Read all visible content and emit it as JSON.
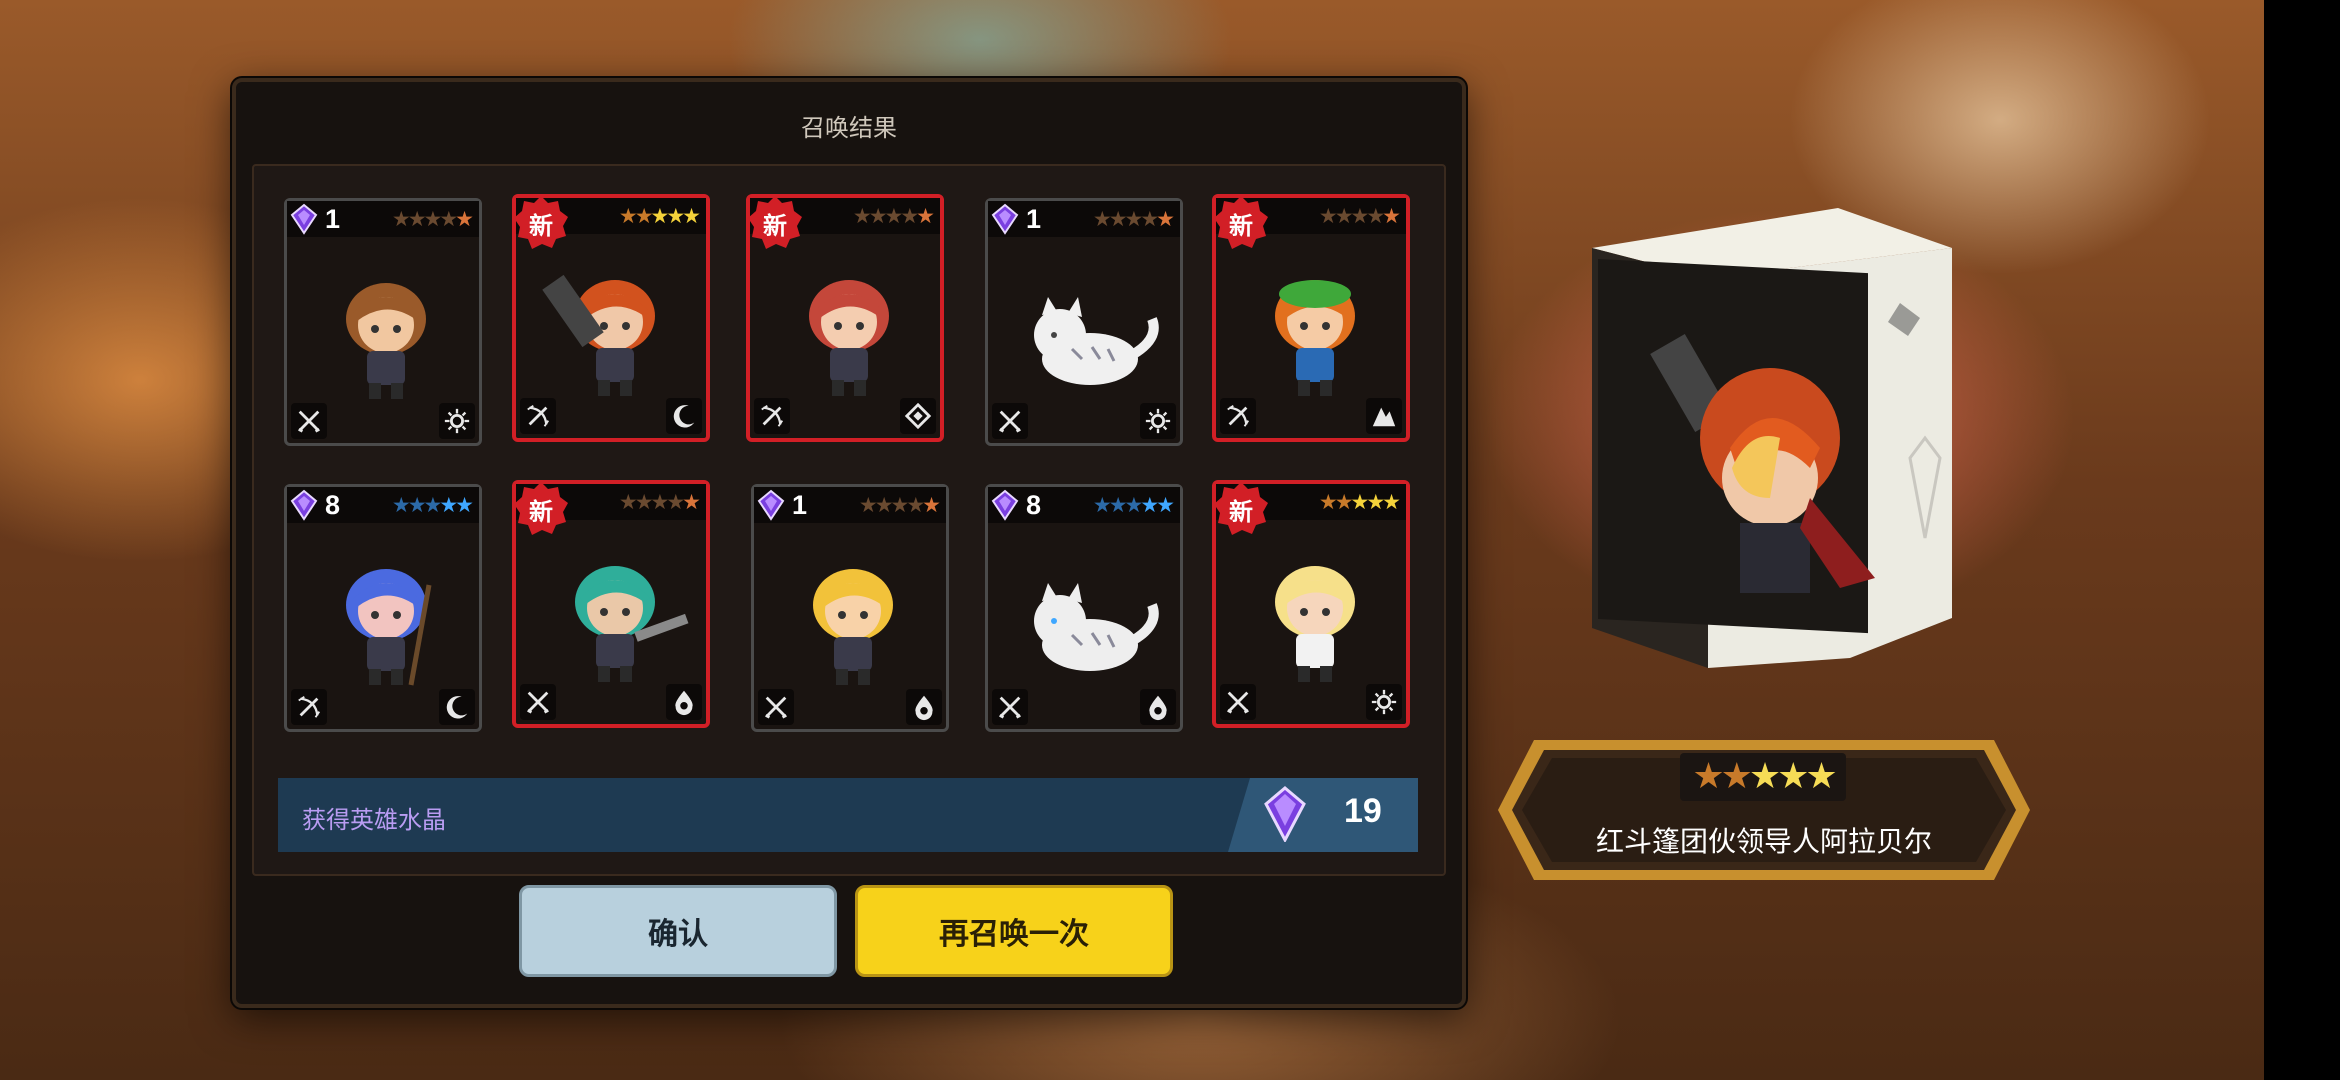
{
  "dialog": {
    "title": "召唤结果"
  },
  "cards": [
    {
      "new": false,
      "new_label": "",
      "dup": "1",
      "stars": 5,
      "star_color": "#d9743a",
      "hero": "brown-haired-boy",
      "class_icon": "swords-icon",
      "element_icon": "sun-icon"
    },
    {
      "new": true,
      "new_label": "新",
      "dup": "",
      "stars": 5,
      "star_color": "#f4d23a",
      "hero": "red-hooded-gunner",
      "class_icon": "bow-icon",
      "element_icon": "moon-icon"
    },
    {
      "new": true,
      "new_label": "新",
      "dup": "",
      "stars": 5,
      "star_color": "#d9743a",
      "hero": "red-haired-girl",
      "class_icon": "bow-icon",
      "element_icon": "diamond-icon"
    },
    {
      "new": false,
      "new_label": "",
      "dup": "1",
      "stars": 5,
      "star_color": "#d9743a",
      "hero": "white-tiger",
      "class_icon": "swords-icon",
      "element_icon": "sun-icon"
    },
    {
      "new": true,
      "new_label": "新",
      "dup": "",
      "stars": 5,
      "star_color": "#d9743a",
      "hero": "green-hat-girl",
      "class_icon": "bow-icon",
      "element_icon": "mountain-icon"
    },
    {
      "new": false,
      "new_label": "",
      "dup": "8",
      "stars": 5,
      "star_color": "#3fa7ff",
      "hero": "blue-haired-mage",
      "class_icon": "bow-icon",
      "element_icon": "moon-icon"
    },
    {
      "new": true,
      "new_label": "新",
      "dup": "",
      "stars": 5,
      "star_color": "#d9743a",
      "hero": "green-haired-swordswoman",
      "class_icon": "swords-icon",
      "element_icon": "water-drop-icon"
    },
    {
      "new": false,
      "new_label": "",
      "dup": "1",
      "stars": 5,
      "star_color": "#d9743a",
      "hero": "blonde-boy",
      "class_icon": "swords-icon",
      "element_icon": "water-drop-icon"
    },
    {
      "new": false,
      "new_label": "",
      "dup": "8",
      "stars": 5,
      "star_color": "#3fa7ff",
      "hero": "white-fox",
      "class_icon": "swords-icon",
      "element_icon": "water-drop-icon"
    },
    {
      "new": true,
      "new_label": "新",
      "dup": "",
      "stars": 5,
      "star_color": "#f4d23a",
      "hero": "blonde-bonnet-lady",
      "class_icon": "swords-icon",
      "element_icon": "sun-icon"
    }
  ],
  "crystal_bar": {
    "label": "获得英雄水晶",
    "value": "19"
  },
  "buttons": {
    "confirm": "确认",
    "summon_again": "再召唤一次"
  },
  "featured": {
    "stars": "★★★★★",
    "name": "红斗篷团伙领导人阿拉贝尔"
  },
  "colors": {
    "new_border": "#d21f26",
    "confirm_bg": "#b8d0dd",
    "again_bg": "#f7d21a",
    "crystal_bar": "#1e3a52"
  }
}
